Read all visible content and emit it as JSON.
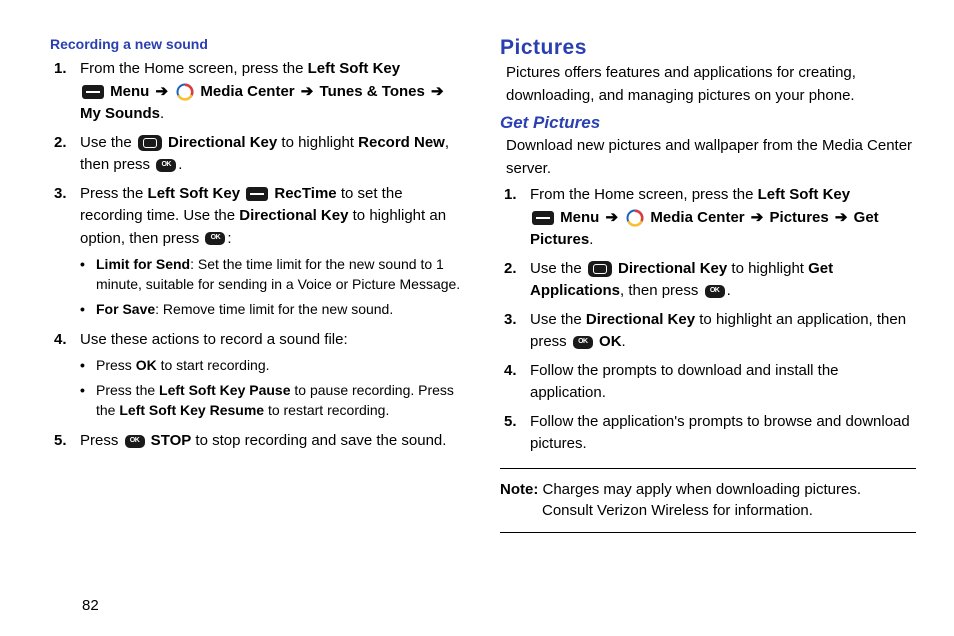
{
  "pageNumber": "82",
  "left": {
    "heading": "Recording a new sound",
    "steps": [
      {
        "n": "1.",
        "pre": "From the Home screen, press the ",
        "b1": "Left Soft Key",
        "menuText": " Menu",
        "mediaText": " Media Center ",
        "tunesText": " Tunes & Tones ",
        "mySounds": "My Sounds",
        "period": "."
      },
      {
        "n": "2.",
        "pre": "Use the ",
        "b1": " Directional Key",
        "mid": " to highlight ",
        "b2": "Record New",
        "after": ", then press ",
        "period": "."
      },
      {
        "n": "3.",
        "pre": "Press the ",
        "b1": "Left Soft Key ",
        "rec": " RecTime",
        "mid": " to set the recording time. Use the ",
        "b2": "Directional Key",
        "after": " to highlight an option, then press ",
        "colon": ":",
        "bullets": [
          {
            "b": "Limit for Send",
            "t": ": Set the time limit for the new sound to 1 minute, suitable for sending in a Voice or Picture Message."
          },
          {
            "b": "For Save",
            "t": ": Remove time limit for the new sound."
          }
        ]
      },
      {
        "n": "4.",
        "pre": "Use these actions to record a sound file:",
        "bullets": [
          {
            "pre": "Press ",
            "b": "OK",
            "t": " to start recording."
          },
          {
            "pre": "Press the ",
            "b": "Left Soft Key Pause",
            "t": " to pause recording. Press the ",
            "b2": "Left Soft Key Resume",
            "t2": " to restart recording."
          }
        ]
      },
      {
        "n": "5.",
        "pre": "Press ",
        "b1": " STOP",
        "after": " to stop recording and save the sound."
      }
    ]
  },
  "right": {
    "heading": "Pictures",
    "intro": "Pictures offers features and applications for creating, downloading, and managing pictures on your phone.",
    "subheading": "Get Pictures",
    "subintro": "Download new pictures and wallpaper from the Media Center server.",
    "steps": [
      {
        "n": "1.",
        "pre": "From the Home screen, press the ",
        "b1": "Left Soft Key",
        "menuText": " Menu",
        "mediaText": " Media Center ",
        "picText": " Pictures ",
        "getPic": " Get Pictures",
        "period": "."
      },
      {
        "n": "2.",
        "pre": "Use the ",
        "b1": " Directional Key",
        "mid": " to highlight ",
        "b2": "Get Applications",
        "after": ", then press ",
        "period": "."
      },
      {
        "n": "3.",
        "pre": "Use the ",
        "b1": "Directional Key",
        "mid": " to highlight an application, then press ",
        "b2": " OK",
        "period": "."
      },
      {
        "n": "4.",
        "pre": "Follow the prompts to download and install the application."
      },
      {
        "n": "5.",
        "pre": "Follow the application's prompts to browse and download pictures."
      }
    ],
    "noteLabel": "Note:",
    "noteText": " Charges may apply when downloading pictures. Consult Verizon Wireless for information."
  },
  "arrow": "➔",
  "ok": "OK"
}
